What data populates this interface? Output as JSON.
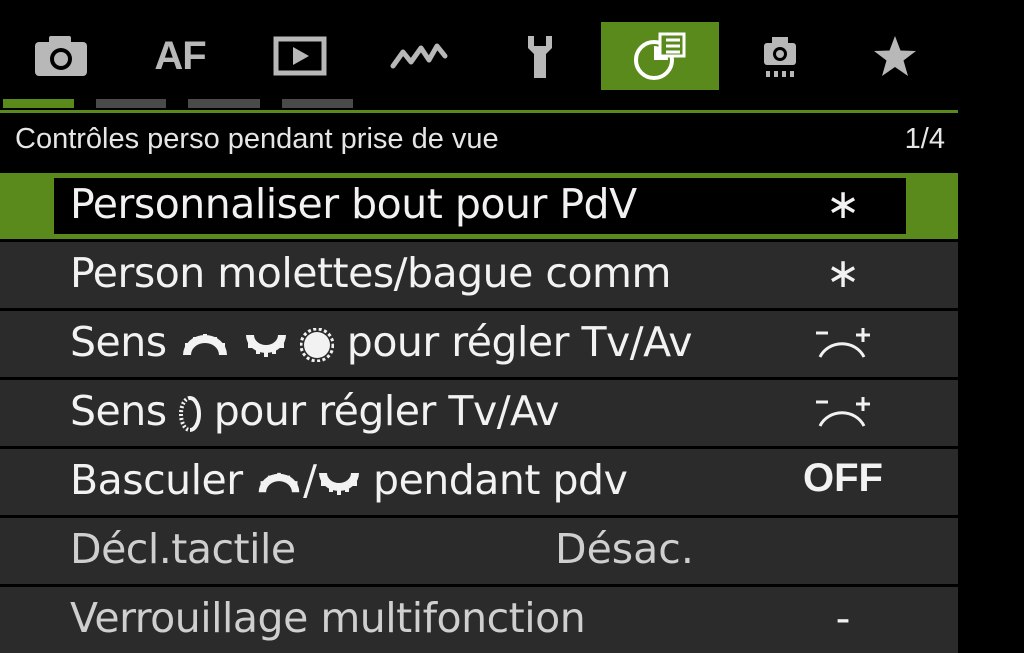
{
  "tabs": [
    {
      "icon": "camera-icon"
    },
    {
      "label": "AF",
      "icon": "af-text"
    },
    {
      "icon": "playback-icon"
    },
    {
      "icon": "wireless-icon"
    },
    {
      "icon": "wrench-icon"
    },
    {
      "icon": "custom-functions-icon",
      "active": true
    },
    {
      "icon": "my-menu-camera-icon"
    },
    {
      "icon": "star-icon"
    }
  ],
  "page_indicator": {
    "count": 4,
    "current": 1
  },
  "header": {
    "title": "Contrôles perso pendant prise de vue",
    "page": "1/4"
  },
  "items": [
    {
      "label": "Personnaliser bout pour PdV",
      "value": "∗"
    },
    {
      "label_pre": "Sens",
      "label_post": "pour régler Tv/Av",
      "icons": [
        "main-dial-icon",
        "quick-dial-icon",
        "control-ring-icon"
      ],
      "value_icon": "direction-minus-plus-icon"
    },
    {
      "label": "Person molettes/bague comm",
      "value": "∗"
    },
    {
      "label_pre": "Sens",
      "label_post": "pour régler Tv/Av",
      "icons": [
        "lens-ring-icon"
      ],
      "value_icon": "direction-minus-plus-icon"
    },
    {
      "label_pre": "Basculer",
      "label_mid": "/",
      "label_post": "pendant pdv",
      "icons": [
        "main-dial-icon",
        "quick-dial-icon"
      ],
      "value": "OFF"
    },
    {
      "label": "Décl.tactile",
      "value": "Désac."
    },
    {
      "label": "Verrouillage multifonction",
      "value": "-"
    }
  ],
  "colors": {
    "accent": "#5a8a1b",
    "row_bg": "#2b2b2b",
    "inactive_icon": "#b8b8b8"
  }
}
